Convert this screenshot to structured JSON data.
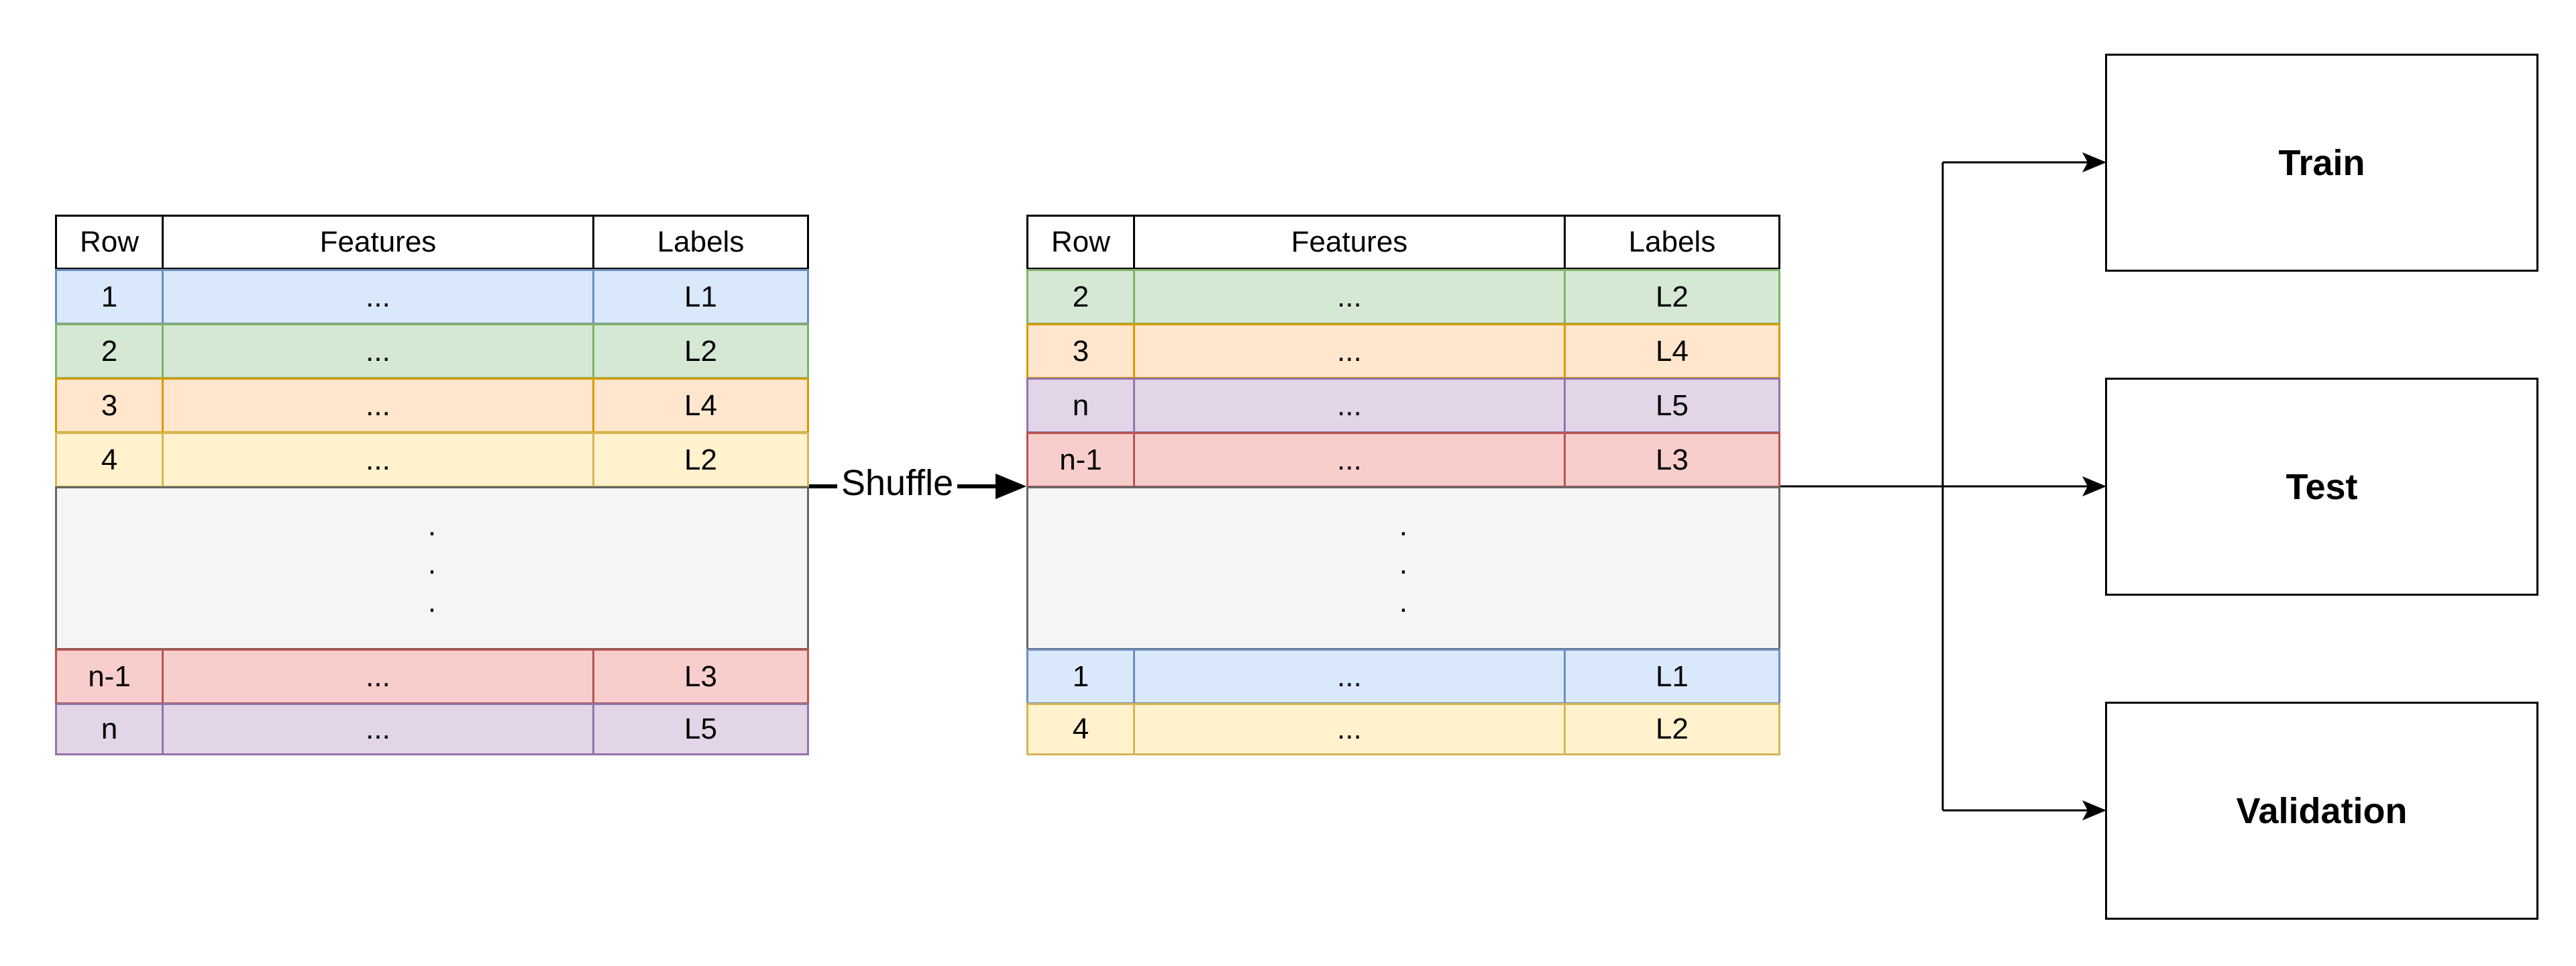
{
  "source_table": {
    "headers": [
      "Row",
      "Features",
      "Labels"
    ],
    "rows": [
      {
        "row": "1",
        "features": "...",
        "label": "L1",
        "color": "#dae8fc"
      },
      {
        "row": "2",
        "features": "...",
        "label": "L2",
        "color": "#d5e8d4"
      },
      {
        "row": "3",
        "features": "...",
        "label": "L4",
        "color": "#ffe6cc"
      },
      {
        "row": "4",
        "features": "...",
        "label": "L2",
        "color": "#fff2cc"
      }
    ],
    "ellipsis": [
      ".",
      ".",
      "."
    ],
    "tail_rows": [
      {
        "row": "n-1",
        "features": "...",
        "label": "L3",
        "color": "#f8cecc"
      },
      {
        "row": "n",
        "features": "...",
        "label": "L5",
        "color": "#e1d5e7"
      }
    ]
  },
  "shuffle": {
    "label": "Shuffle"
  },
  "shuffled_table": {
    "headers": [
      "Row",
      "Features",
      "Labels"
    ],
    "rows": [
      {
        "row": "2",
        "features": "...",
        "label": "L2",
        "color": "#d5e8d4"
      },
      {
        "row": "3",
        "features": "...",
        "label": "L4",
        "color": "#ffe6cc"
      },
      {
        "row": "n",
        "features": "...",
        "label": "L5",
        "color": "#e1d5e7"
      },
      {
        "row": "n-1",
        "features": "...",
        "label": "L3",
        "color": "#f8cecc"
      }
    ],
    "ellipsis": [
      ".",
      ".",
      "."
    ],
    "tail_rows": [
      {
        "row": "1",
        "features": "...",
        "label": "L1",
        "color": "#dae8fc"
      },
      {
        "row": "4",
        "features": "...",
        "label": "L2",
        "color": "#fff2cc"
      }
    ]
  },
  "splits": {
    "train": "Train",
    "test": "Test",
    "validation": "Validation"
  }
}
